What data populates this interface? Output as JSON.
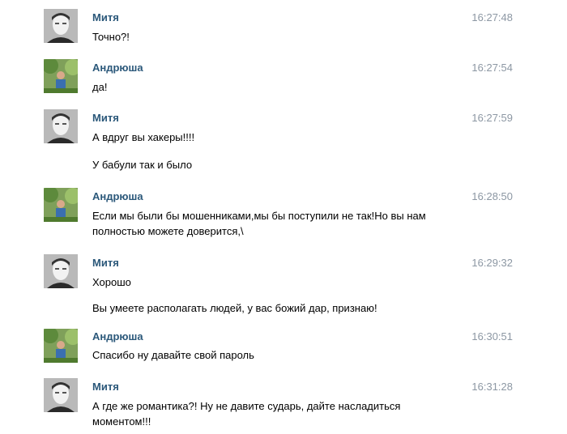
{
  "chat": {
    "messages": [
      {
        "author": "Митя",
        "avatar": "mitya-avatar",
        "time": "16:27:48",
        "lines": [
          "Точно?!"
        ]
      },
      {
        "author": "Андрюша",
        "avatar": "andryusha-avatar",
        "time": "16:27:54",
        "lines": [
          "да!"
        ]
      },
      {
        "author": "Митя",
        "avatar": "mitya-avatar",
        "time": "16:27:59",
        "lines": [
          "А вдруг вы хакеры!!!!",
          "У бабули так и было"
        ]
      },
      {
        "author": "Андрюша",
        "avatar": "andryusha-avatar",
        "time": "16:28:50",
        "lines": [
          "Если мы были бы мошенниками,мы бы поступили не так!Но вы нам полностью можете доверится,\\"
        ]
      },
      {
        "author": "Митя",
        "avatar": "mitya-avatar",
        "time": "16:29:32",
        "lines": [
          "Хорошо",
          "Вы умеете располагать людей, у вас божий дар, признаю!"
        ]
      },
      {
        "author": "Андрюша",
        "avatar": "andryusha-avatar",
        "time": "16:30:51",
        "lines": [
          "Спасибо ну давайте свой пароль"
        ]
      },
      {
        "author": "Митя",
        "avatar": "mitya-avatar",
        "time": "16:31:28",
        "lines": [
          "А где же романтика?! Ну не давите сударь, дайте насладиться моментом!!!"
        ]
      }
    ]
  }
}
